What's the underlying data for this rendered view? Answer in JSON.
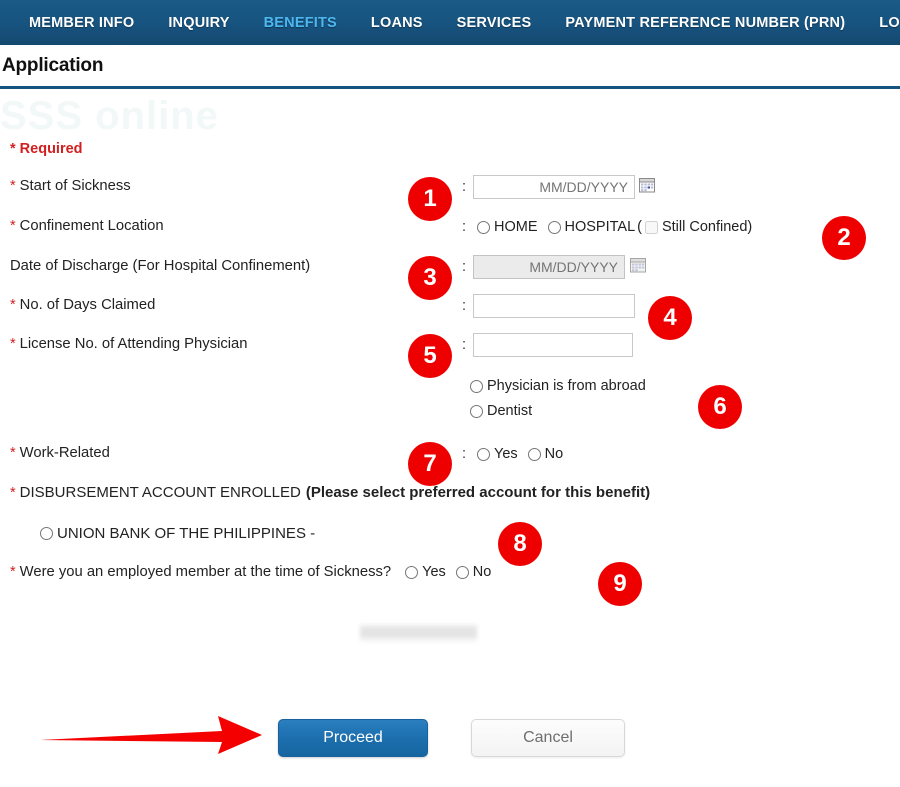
{
  "nav": {
    "items": [
      {
        "label": "MEMBER INFO",
        "active": false
      },
      {
        "label": "INQUIRY",
        "active": false
      },
      {
        "label": "BENEFITS",
        "active": true
      },
      {
        "label": "LOANS",
        "active": false
      },
      {
        "label": "SERVICES",
        "active": false
      },
      {
        "label": "PAYMENT REFERENCE NUMBER (PRN)",
        "active": false
      },
      {
        "label": "LOG",
        "active": false
      }
    ]
  },
  "header": {
    "title": "Application",
    "watermark": "SSS online"
  },
  "form": {
    "required_note": "* Required",
    "asterisk": "*",
    "colon": ":",
    "fields": {
      "start_of_sickness": {
        "label": "Start of Sickness",
        "value": "",
        "placeholder": "MM/DD/YYYY"
      },
      "confinement_location": {
        "label": "Confinement Location",
        "option_home": "HOME",
        "option_hospital": "HOSPITAL",
        "paren_open": "(",
        "still_confined": "Still Confined",
        "paren_close": ")"
      },
      "date_of_discharge": {
        "label": "Date of Discharge (For Hospital Confinement)",
        "value": "",
        "placeholder": "MM/DD/YYYY"
      },
      "days_claimed": {
        "label": "No. of Days Claimed",
        "value": ""
      },
      "license_no": {
        "label": "License No. of Attending Physician",
        "value": ""
      },
      "physician_abroad": {
        "label": "Physician is from abroad"
      },
      "dentist": {
        "label": "Dentist"
      },
      "work_related": {
        "label": "Work-Related",
        "option_yes": "Yes",
        "option_no": "No"
      },
      "disbursement": {
        "label": "DISBURSEMENT ACCOUNT ENROLLED",
        "note": "(Please select preferred account for this benefit)",
        "bank_label": "UNION BANK OF THE PHILIPPINES -",
        "bank_account_masked": ""
      },
      "employed_member": {
        "label": "Were you an employed member at the time of Sickness?",
        "option_yes": "Yes",
        "option_no": "No"
      }
    },
    "buttons": {
      "proceed": "Proceed",
      "cancel": "Cancel"
    }
  },
  "annotations": {
    "markers": [
      "1",
      "2",
      "3",
      "4",
      "5",
      "6",
      "7",
      "8",
      "9"
    ],
    "arrow": "red-arrow-pointing-to-proceed"
  },
  "colors": {
    "nav_background": "#17537f",
    "nav_active_text": "#4db8f0",
    "required_red": "#d21f1f",
    "marker_red": "#ee0000",
    "proceed_blue": "#1d6fae",
    "heading_border": "#17537f"
  }
}
